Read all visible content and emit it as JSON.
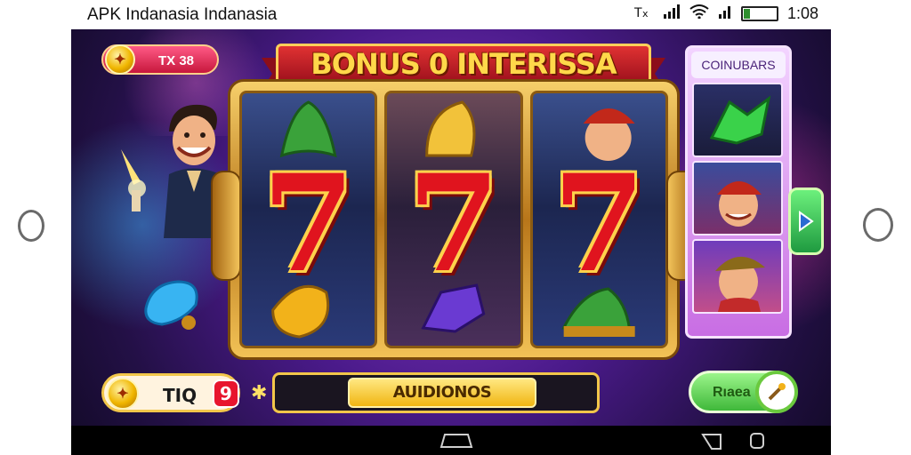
{
  "status_bar": {
    "title": "APK Indanasia  Indanasia",
    "time": "1:08",
    "icons": [
      "network-icon",
      "signal-icon",
      "wifi-icon",
      "signal-icon",
      "battery-icon"
    ]
  },
  "game": {
    "balance": {
      "label": "TX 38"
    },
    "banner": {
      "title": "BONUS 0 INTERISSA"
    },
    "reels": [
      {
        "center_symbol": "7",
        "top_symbol": "green-leaf",
        "bottom_symbol": "gold-drop"
      },
      {
        "center_symbol": "7",
        "top_symbol": "gold-drop",
        "bottom_symbol": "purple-gem"
      },
      {
        "center_symbol": "7",
        "top_symbol": "character",
        "bottom_symbol": "green-leaf"
      }
    ],
    "side_panel": {
      "title": "COINUBARS",
      "tiles": [
        "green-star",
        "character",
        "character"
      ]
    },
    "bet": {
      "label": "TIQ",
      "badge": "9"
    },
    "progress": {
      "button_label": "AUIDIONOS"
    },
    "spin": {
      "label": "Rıaea"
    }
  },
  "colors": {
    "background": "#4a1a8a",
    "banner_red": "#c71a25",
    "gold": "#f2c64a",
    "seven_red": "#e0141e",
    "green_button": "#3fb83a"
  }
}
